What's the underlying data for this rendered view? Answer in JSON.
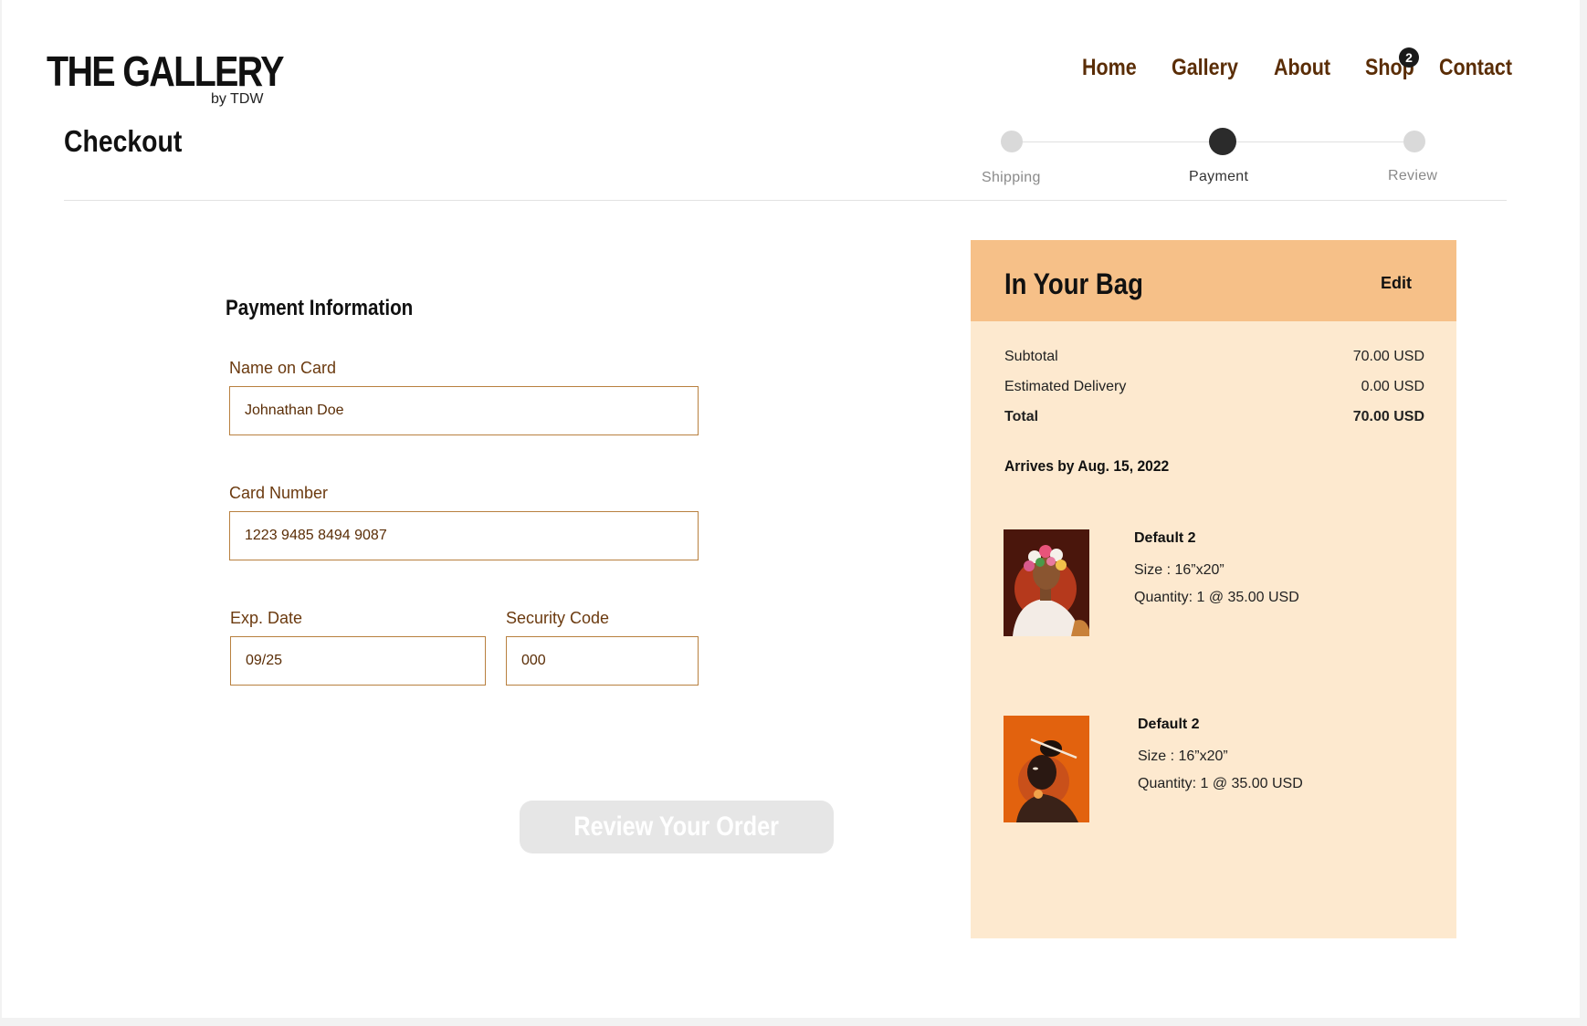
{
  "brand": {
    "title": "THE GALLERY",
    "subtitle": "by TDW"
  },
  "nav": {
    "items": [
      {
        "label": "Home"
      },
      {
        "label": "Gallery"
      },
      {
        "label": "About"
      },
      {
        "label": "Shop"
      },
      {
        "label": "Contact"
      }
    ],
    "cart_count": "2"
  },
  "checkout": {
    "title": "Checkout",
    "steps": [
      {
        "label": "Shipping",
        "active": false
      },
      {
        "label": "Payment",
        "active": true
      },
      {
        "label": "Review",
        "active": false
      }
    ]
  },
  "payment": {
    "heading": "Payment Information",
    "name_label": "Name on Card",
    "name_value": "Johnathan Doe",
    "card_label": "Card Number",
    "card_value": "1223 9485 8494 9087",
    "exp_label": "Exp. Date",
    "exp_value": "09/25",
    "cvv_label": "Security Code",
    "cvv_value": "000",
    "submit_label": "Review Your Order"
  },
  "bag": {
    "title": "In Your Bag",
    "edit_label": "Edit",
    "subtotal_label": "Subtotal",
    "subtotal_value": "70.00 USD",
    "delivery_label": "Estimated Delivery",
    "delivery_value": "0.00 USD",
    "total_label": "Total",
    "total_value": "70.00 USD",
    "arrives": "Arrives by Aug. 15, 2022",
    "items": [
      {
        "name": "Default 2",
        "size": "Size : 16”x20”",
        "quantity": "Quantity: 1 @ 35.00 USD",
        "image": "artwork-flower-crown"
      },
      {
        "name": "Default 2",
        "size": "Size : 16”x20”",
        "quantity": "Quantity: 1 @ 35.00 USD",
        "image": "artwork-orange-portrait"
      }
    ]
  },
  "colors": {
    "accent_brown": "#5a2d06",
    "bag_header": "#f6c088",
    "bag_body": "#fde9cf",
    "field_border": "#b8803f",
    "button_disabled": "#e6e6e6"
  }
}
